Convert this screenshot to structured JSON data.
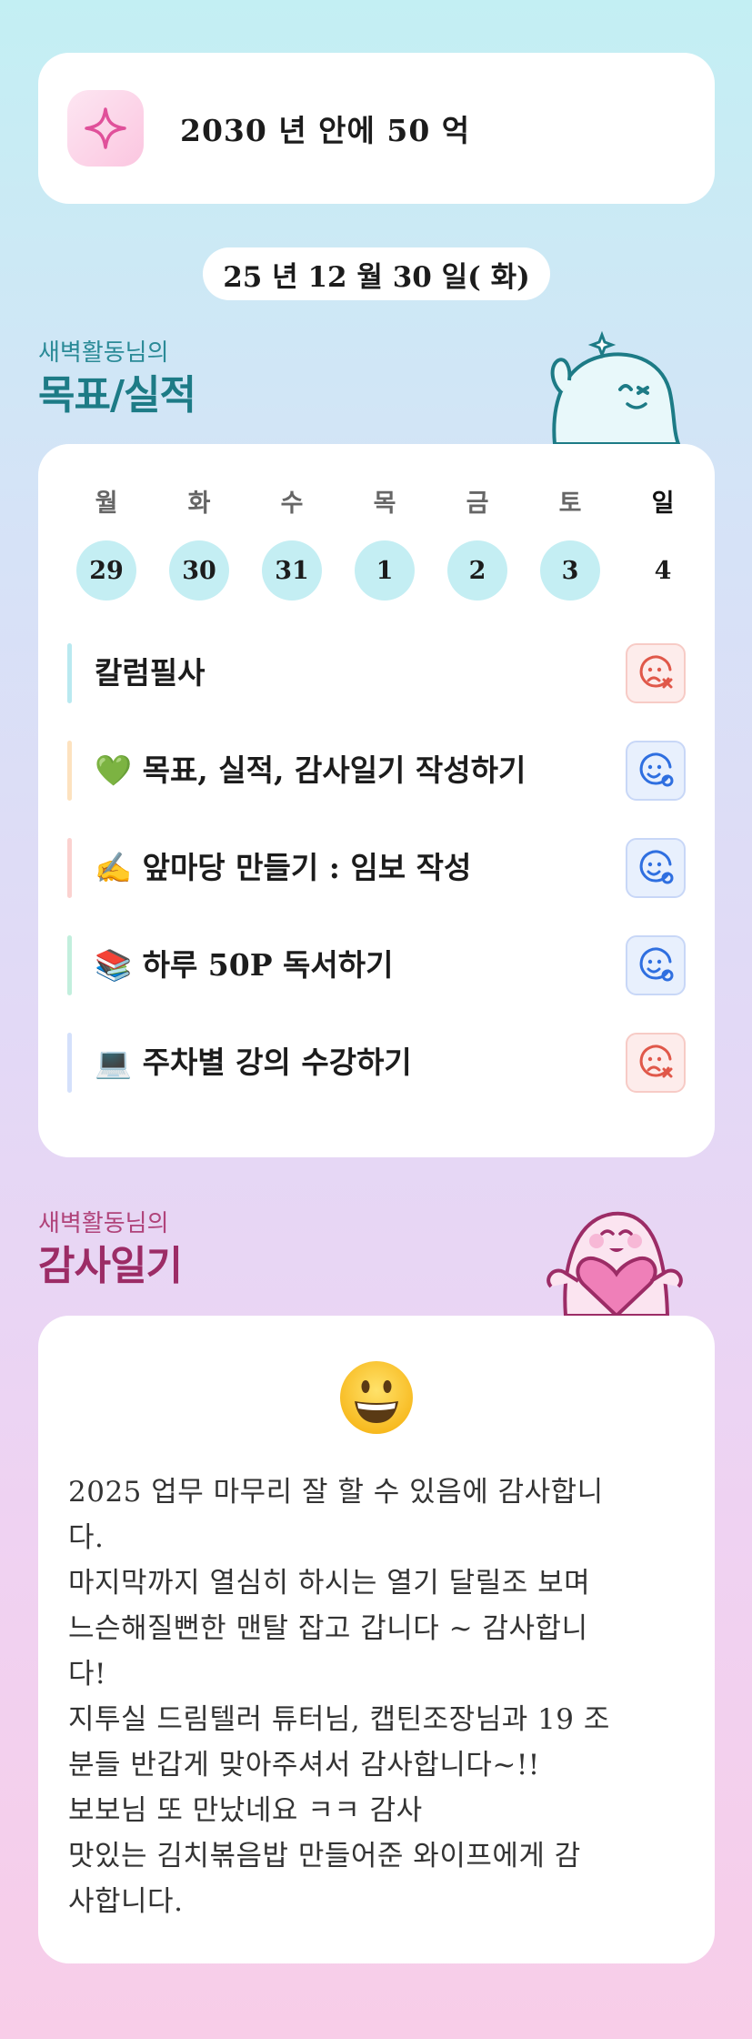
{
  "goal": {
    "text": "2030 년 안에 50 억",
    "icon": "sparkle-icon"
  },
  "date": "25 년 12 월 30 일( 화)",
  "goals_section": {
    "subtitle": "새벽활동님의",
    "title": "목표/실적"
  },
  "week": {
    "days": [
      "월",
      "화",
      "수",
      "목",
      "금",
      "토",
      "일"
    ],
    "dates": [
      "29",
      "30",
      "31",
      "1",
      "2",
      "3",
      "4"
    ],
    "completed": [
      true,
      true,
      true,
      true,
      true,
      true,
      false
    ]
  },
  "tasks": [
    {
      "label": "칼럼필사",
      "bar_color": "#b9e9f0",
      "status": "fail",
      "status_icon": "sad-face-x-icon"
    },
    {
      "label": "💚 목표, 실적, 감사일기 작성하기",
      "bar_color": "#fde2bf",
      "status": "done",
      "status_icon": "happy-face-check-icon"
    },
    {
      "label": "✍️ 앞마당 만들기 : 임보 작성",
      "bar_color": "#fbd2d0",
      "status": "done",
      "status_icon": "happy-face-check-icon"
    },
    {
      "label": "📚 하루 50P  독서하기",
      "bar_color": "#c2efdd",
      "status": "done",
      "status_icon": "happy-face-check-icon"
    },
    {
      "label": "💻 주차별 강의 수강하기",
      "bar_color": "#d4e0fb",
      "status": "fail",
      "status_icon": "sad-face-x-icon"
    }
  ],
  "gratitude_section": {
    "subtitle": "새벽활동님의",
    "title": "감사일기"
  },
  "gratitude": {
    "emoji": "grinning-face-icon",
    "lines": [
      "2025  업무 마무리 잘 할 수 있음에 감사합니",
      "다.",
      "마지막까지 열심히 하시는 열기 달릴조 보며",
      "느슨해질뻔한 맨탈 잡고 갑니다 ~ 감사합니",
      "다!",
      "지투실 드림텔러 튜터님, 캡틴조장님과 19 조",
      "분들 반갑게 맞아주셔서 감사합니다~!!",
      "보보님 또 만났네요 ㅋㅋ 감사",
      "맛있는 김치볶음밥 만들어준 와이프에게 감",
      "사합니다."
    ]
  },
  "colors": {
    "teal": "#1d7b86",
    "pink": "#9c2c66",
    "done_circle": "#c4eef3",
    "fail": "#e0584a",
    "ok": "#2f6fe0"
  }
}
